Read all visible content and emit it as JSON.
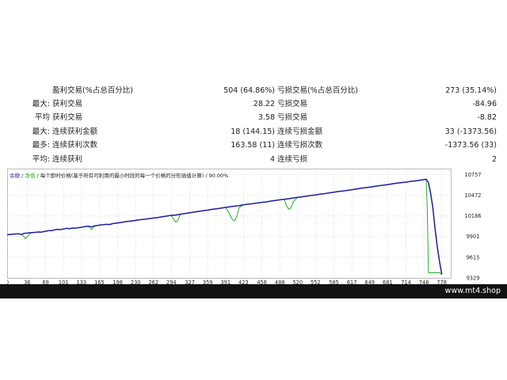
{
  "stats": {
    "rows": [
      {
        "label": "",
        "name1": "盈利交易(%占总百分比)",
        "val1": "504 (64.86%)",
        "name2": "亏损交易(%占总百分比)",
        "val2": "273 (35.14%)"
      },
      {
        "label": "最大:",
        "name1": "获利交易",
        "val1": "28.22",
        "name2": "亏损交易",
        "val2": "-84.96"
      },
      {
        "label": "平均",
        "name1": "获利交易",
        "val1": "3.58",
        "name2": "亏损交易",
        "val2": "-8.82"
      },
      {
        "label": "最大:",
        "name1": "连续获利金额",
        "val1": "18 (144.15)",
        "name2": "连续亏损金额",
        "val2": "33 (-1373.56)"
      },
      {
        "label": "最多:",
        "name1": "连续获利次数",
        "val1": "163.58 (11)",
        "name2": "连续亏损次数",
        "val2": "-1373.56 (33)"
      },
      {
        "label": "平均:",
        "name1": "连续获利",
        "val1": "4",
        "name2": "连续亏损",
        "val2": "2"
      }
    ]
  },
  "legend": {
    "balance": "余额",
    "equity": "净值",
    "text": "每个即时价格(基于所有可利用的最小时段的每一个价格的分形插值计算) / 90.00%"
  },
  "colors": {
    "balance_line": "#1c1ca6",
    "equity_line": "#22b222",
    "grid": "#c8c8c8",
    "footer_bg": "#121212"
  },
  "chart_data": {
    "type": "line",
    "x_ticks": [
      "0",
      "36",
      "69",
      "101",
      "133",
      "165",
      "198",
      "230",
      "262",
      "294",
      "327",
      "359",
      "391",
      "423",
      "456",
      "488",
      "520",
      "552",
      "585",
      "617",
      "649",
      "681",
      "714",
      "746",
      "778"
    ],
    "y_ticks": [
      "10757",
      "10472",
      "10186",
      "9901",
      "9615",
      "9329"
    ],
    "xlim": [
      0,
      794
    ],
    "ylim": [
      9329,
      10842
    ],
    "series": [
      {
        "key": "balance",
        "x": [
          0,
          10,
          20,
          26,
          30,
          36,
          42,
          48,
          52,
          56,
          60,
          66,
          69,
          75,
          80,
          85,
          90,
          95,
          101,
          107,
          112,
          117,
          122,
          128,
          133,
          139,
          145,
          151,
          157,
          162,
          165,
          171,
          177,
          183,
          189,
          194,
          198,
          206,
          214,
          222,
          230,
          238,
          246,
          254,
          262,
          270,
          278,
          286,
          294,
          302,
          310,
          318,
          327,
          335,
          343,
          351,
          359,
          367,
          375,
          383,
          391,
          399,
          407,
          415,
          423,
          431,
          439,
          447,
          456,
          464,
          472,
          480,
          488,
          496,
          504,
          512,
          520,
          528,
          536,
          544,
          552,
          560,
          568,
          576,
          585,
          593,
          601,
          609,
          617,
          625,
          633,
          641,
          649,
          657,
          665,
          673,
          681,
          689,
          697,
          705,
          714,
          722,
          730,
          738,
          746,
          750,
          754,
          758,
          762,
          766,
          770,
          774,
          778
        ],
        "y": [
          9925,
          9935,
          9940,
          9930,
          9945,
          9950,
          9955,
          9958,
          9960,
          9965,
          9962,
          9970,
          9975,
          9985,
          9982,
          9995,
          10000,
          9998,
          10005,
          10015,
          10010,
          10020,
          10018,
          10025,
          10030,
          10040,
          10045,
          10035,
          10050,
          10055,
          10060,
          10065,
          10070,
          10068,
          10080,
          10085,
          10090,
          10100,
          10110,
          10115,
          10125,
          10135,
          10140,
          10150,
          10158,
          10165,
          10175,
          10185,
          10195,
          10200,
          10210,
          10220,
          10230,
          10240,
          10250,
          10260,
          10268,
          10278,
          10285,
          10295,
          10305,
          10315,
          10322,
          10330,
          10340,
          10350,
          10355,
          10365,
          10375,
          10382,
          10392,
          10400,
          10410,
          10418,
          10425,
          10435,
          10445,
          10452,
          10460,
          10470,
          10478,
          10488,
          10495,
          10505,
          10515,
          10525,
          10533,
          10540,
          10550,
          10560,
          10570,
          10578,
          10585,
          10595,
          10605,
          10612,
          10620,
          10630,
          10640,
          10648,
          10655,
          10665,
          10672,
          10680,
          10690,
          10695,
          10650,
          10500,
          10300,
          10000,
          9750,
          9550,
          9375
        ]
      },
      {
        "key": "equity",
        "x": [
          0,
          20,
          26,
          30,
          33,
          36,
          42,
          48,
          52,
          56,
          62,
          66,
          69,
          75,
          80,
          85,
          90,
          95,
          101,
          107,
          112,
          117,
          122,
          128,
          133,
          139,
          145,
          151,
          157,
          162,
          165,
          171,
          177,
          183,
          189,
          194,
          198,
          206,
          214,
          222,
          230,
          238,
          246,
          254,
          262,
          270,
          278,
          286,
          294,
          298,
          302,
          306,
          310,
          318,
          327,
          335,
          343,
          351,
          359,
          367,
          375,
          383,
          391,
          399,
          403,
          407,
          411,
          415,
          423,
          431,
          439,
          447,
          456,
          464,
          472,
          480,
          488,
          496,
          500,
          504,
          508,
          512,
          520,
          528,
          536,
          544,
          552,
          560,
          568,
          576,
          585,
          593,
          601,
          609,
          617,
          625,
          633,
          641,
          649,
          657,
          665,
          673,
          681,
          689,
          697,
          705,
          714,
          722,
          730,
          738,
          746,
          750,
          752,
          754,
          758,
          762,
          766,
          770,
          774,
          778
        ],
        "y": [
          9925,
          9940,
          9930,
          9900,
          9870,
          9900,
          9950,
          9958,
          9960,
          9965,
          9962,
          9970,
          9975,
          9985,
          9982,
          9995,
          10000,
          9998,
          10005,
          10015,
          10010,
          10020,
          10018,
          10025,
          10030,
          10040,
          10045,
          10000,
          10050,
          10055,
          10060,
          10065,
          10070,
          10068,
          10080,
          10085,
          10090,
          10100,
          10110,
          10115,
          10125,
          10135,
          10140,
          10150,
          10158,
          10165,
          10175,
          10185,
          10195,
          10140,
          10100,
          10130,
          10210,
          10220,
          10230,
          10240,
          10250,
          10260,
          10268,
          10278,
          10285,
          10295,
          10305,
          10200,
          10140,
          10120,
          10180,
          10300,
          10340,
          10350,
          10355,
          10365,
          10375,
          10382,
          10392,
          10400,
          10410,
          10418,
          10330,
          10280,
          10300,
          10380,
          10445,
          10452,
          10460,
          10470,
          10478,
          10488,
          10495,
          10505,
          10515,
          10525,
          10533,
          10540,
          10550,
          10560,
          10570,
          10578,
          10585,
          10595,
          10605,
          10612,
          10620,
          10630,
          10640,
          10648,
          10655,
          10665,
          10672,
          10680,
          10690,
          10695,
          10250,
          9400,
          9400,
          9400,
          9400,
          9400,
          9400,
          9375
        ]
      }
    ]
  },
  "footer": {
    "site": "www.mt4.shop"
  }
}
